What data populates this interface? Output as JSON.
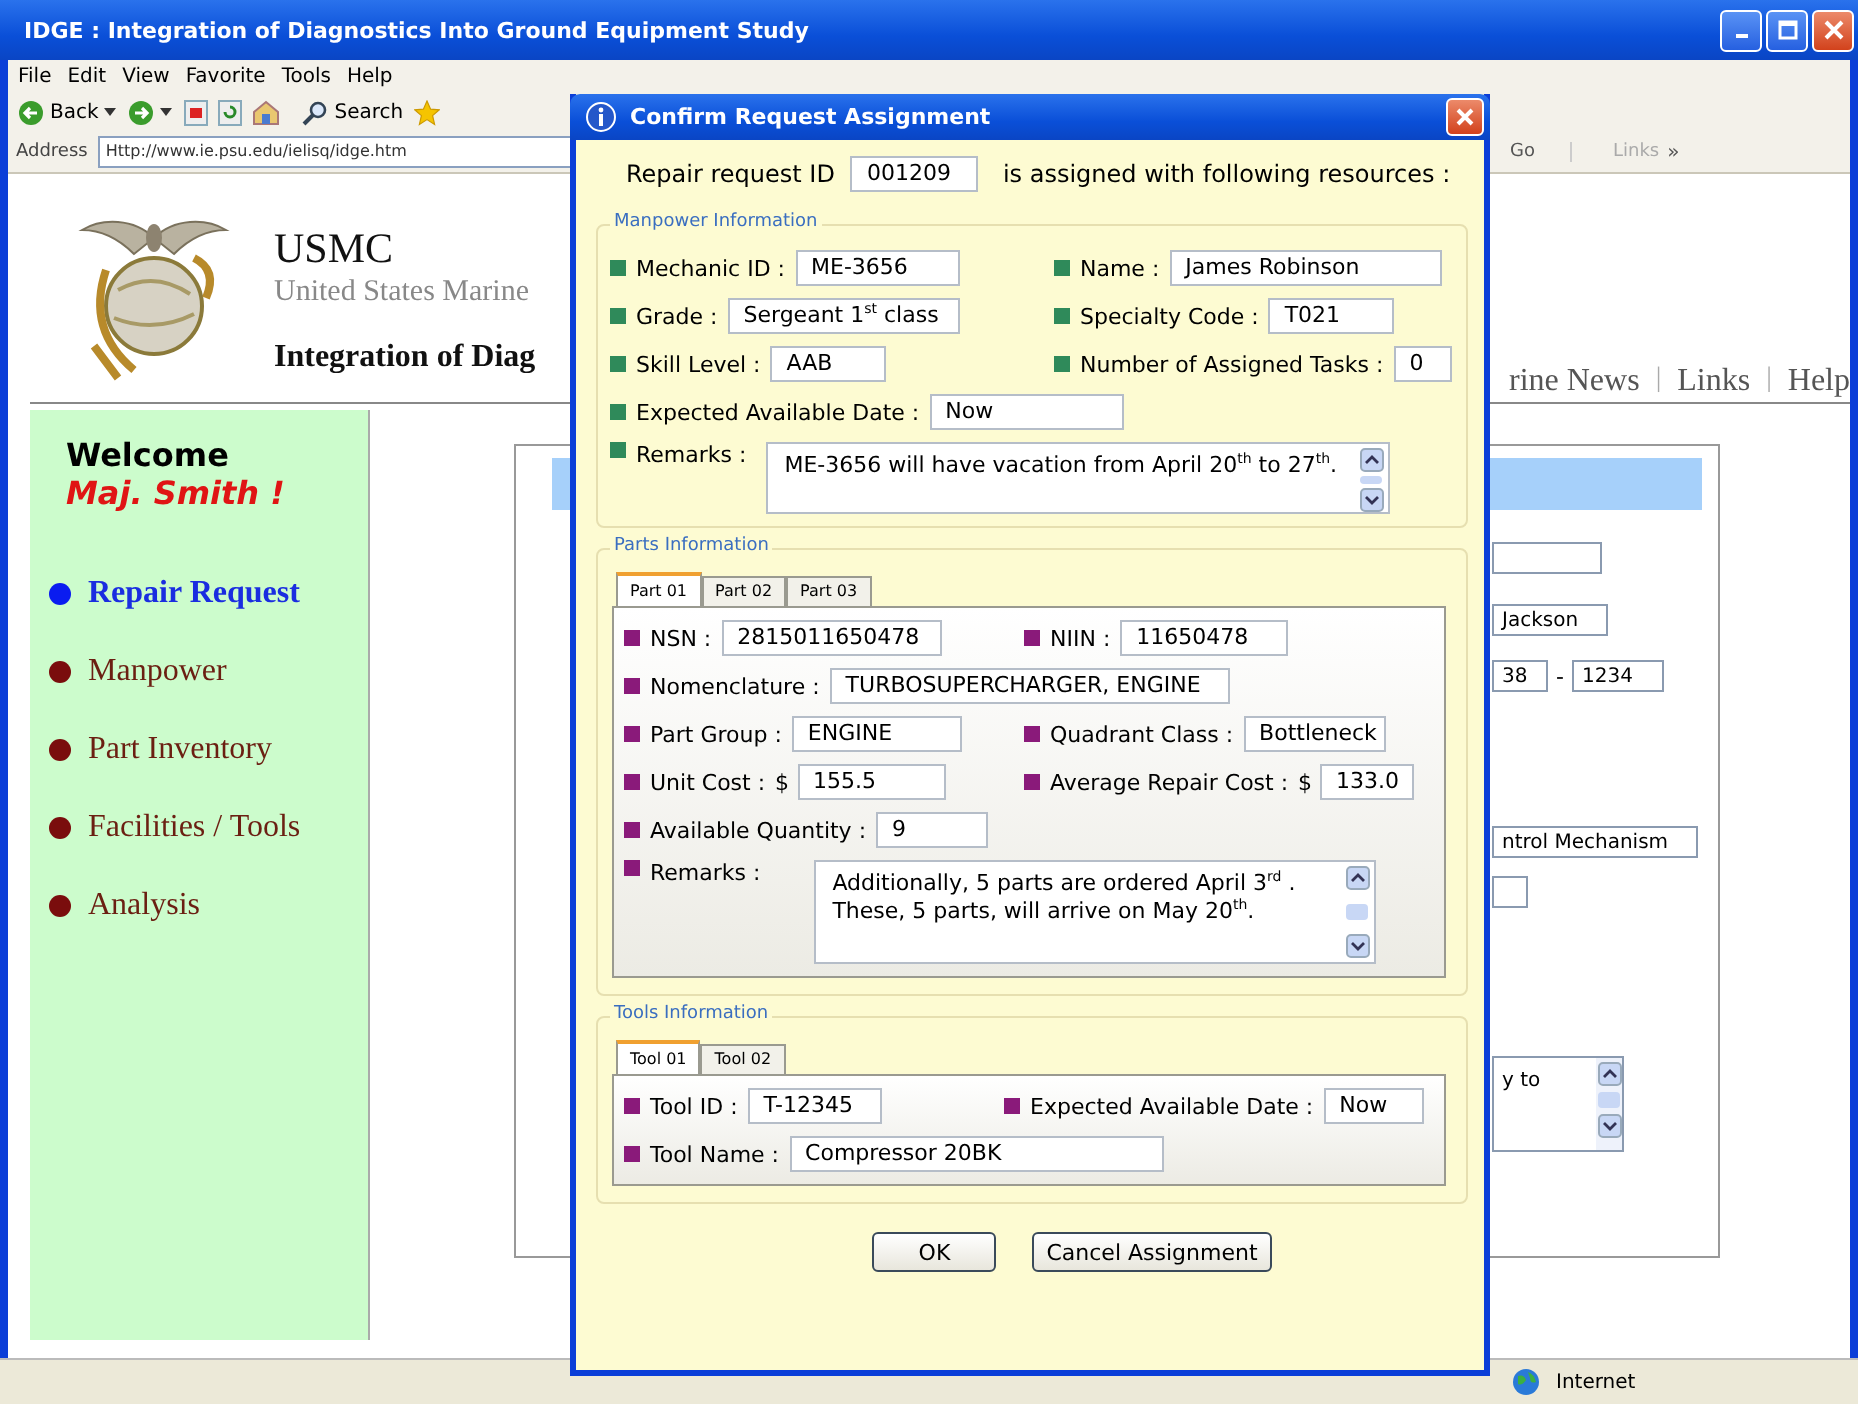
{
  "window": {
    "title": "IDGE : Integration of Diagnostics Into Ground Equipment Study"
  },
  "menu": [
    {
      "label": "File"
    },
    {
      "label": "Edit"
    },
    {
      "label": "View"
    },
    {
      "label": "Favorite"
    },
    {
      "label": "Tools"
    },
    {
      "label": "Help"
    }
  ],
  "toolbar": {
    "back": "Back",
    "search": "Search"
  },
  "address_bar": {
    "label": "Address",
    "value": "Http://www.ie.psu.edu/ielisq/idge.htm",
    "go": "Go",
    "links": "Links",
    "links_more": "»"
  },
  "page": {
    "header": {
      "title": "USMC",
      "subtitle": "United States Marine",
      "project": "Integration of Diag"
    },
    "top_nav": [
      {
        "kind": "link",
        "text": "rine News"
      },
      {
        "kind": "separator",
        "text": "|"
      },
      {
        "kind": "link",
        "text": "Links"
      },
      {
        "kind": "separator",
        "text": "|"
      },
      {
        "kind": "link",
        "text": "Help"
      }
    ],
    "sidebar": {
      "welcome": "Welcome",
      "user": "Maj. Smith !",
      "items": [
        {
          "label": "Repair Request",
          "selected": true
        },
        {
          "label": "Manpower",
          "selected": false
        },
        {
          "label": "Part Inventory",
          "selected": false
        },
        {
          "label": "Facilities / Tools",
          "selected": false
        },
        {
          "label": "Analysis",
          "selected": false
        }
      ]
    },
    "form_fragments": [
      [
        {
          "kind": "field"
        }
      ],
      [
        {
          "kind": "field",
          "value": "Jackson"
        }
      ],
      [
        {
          "kind": "field",
          "value": "38"
        },
        {
          "kind": "text",
          "text": "-"
        },
        {
          "kind": "field",
          "value": "1234"
        }
      ],
      [
        {
          "kind": "field",
          "value": "ntrol Mechanism"
        }
      ],
      [
        {
          "kind": "field"
        }
      ],
      [
        {
          "kind": "textarea",
          "value": "y to"
        }
      ]
    ]
  },
  "dialog": {
    "title": "Confirm Request Assignment",
    "request": {
      "prefix": "Repair request ID",
      "id": "001209",
      "suffix": "is assigned with following resources :"
    },
    "sections": [
      {
        "kind": "manpower",
        "legend": "Manpower Information",
        "rows": [
          [
            {
              "kind": "text",
              "label": "Mechanic ID :",
              "value": "ME-3656"
            },
            {
              "kind": "text",
              "label": "Name :",
              "value": "James Robinson"
            }
          ],
          [
            {
              "kind": "text",
              "label": "Grade :",
              "value": "Sergeant 1$^{st}$ class"
            },
            {
              "kind": "text",
              "label": "Specialty Code :",
              "value": "T021"
            }
          ],
          [
            {
              "kind": "text",
              "label": "Skill Level :",
              "value": "AAB"
            },
            {
              "kind": "text",
              "label": "Number of Assigned Tasks :",
              "value": "0"
            }
          ],
          [
            {
              "kind": "text",
              "label": "Expected Available Date :",
              "value": "Now"
            }
          ],
          [
            {
              "kind": "textarea",
              "label": "Remarks :",
              "value": "ME-3656 will have vacation from April 20$^{th}$ to 27$^{th}$."
            }
          ]
        ]
      },
      {
        "kind": "parts",
        "legend": "Parts Information",
        "tabs": [
          {
            "label": "Part 01",
            "selected": true
          },
          {
            "label": "Part 02",
            "selected": false
          },
          {
            "label": "Part 03",
            "selected": false
          }
        ],
        "rows": [
          [
            {
              "kind": "text",
              "label": "NSN :",
              "value": "2815011650478"
            },
            {
              "kind": "text",
              "label": "NIIN :",
              "value": "11650478"
            }
          ],
          [
            {
              "kind": "text",
              "label": "Nomenclature :",
              "value": "TURBOSUPERCHARGER, ENGINE"
            }
          ],
          [
            {
              "kind": "text",
              "label": "Part Group :",
              "value": "ENGINE"
            },
            {
              "kind": "text",
              "label": "Quadrant Class :",
              "value": "Bottleneck"
            }
          ],
          [
            {
              "kind": "text",
              "label": "Unit Cost :",
              "prefix": "$",
              "value": "155.5"
            },
            {
              "kind": "text",
              "label": "Average Repair Cost :",
              "prefix": "$",
              "value": "133.0"
            }
          ],
          [
            {
              "kind": "text",
              "label": "Available Quantity :",
              "value": "9"
            }
          ],
          [
            {
              "kind": "textarea",
              "label": "Remarks :",
              "value": "Additionally, 5 parts are ordered April 3$^{rd}$ . These, 5 parts, will arrive on May 20$^{th}$."
            }
          ]
        ]
      },
      {
        "kind": "tools",
        "legend": "Tools Information",
        "tabs": [
          {
            "label": "Tool 01",
            "selected": true
          },
          {
            "label": "Tool 02",
            "selected": false
          }
        ],
        "rows": [
          [
            {
              "kind": "text",
              "label": "Tool ID :",
              "value": "T-12345"
            },
            {
              "kind": "text",
              "label": "Expected Available Date :",
              "value": "Now"
            }
          ],
          [
            {
              "kind": "text",
              "label": "Tool Name :",
              "value": "Compressor 20BK"
            }
          ]
        ]
      }
    ],
    "buttons": [
      {
        "label": "OK"
      },
      {
        "label": "Cancel Assignment"
      }
    ]
  },
  "status_bar": {
    "zone": "Internet"
  }
}
